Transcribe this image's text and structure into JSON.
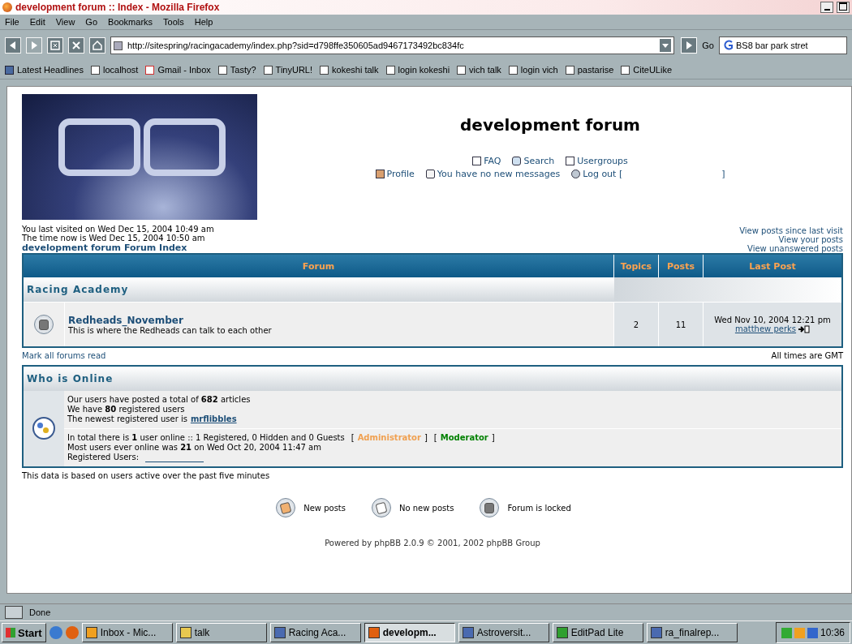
{
  "window": {
    "title": "development forum :: Index - Mozilla Firefox"
  },
  "menu": [
    "File",
    "Edit",
    "View",
    "Go",
    "Bookmarks",
    "Tools",
    "Help"
  ],
  "toolbar": {
    "url": "http://sitespring/racingacademy/index.php?sid=d798ffe350605ad9467173492bc834fc",
    "go": "Go",
    "search": "BS8 bar park stret"
  },
  "bookmarks": [
    {
      "label": "Latest Headlines",
      "kind": "feed"
    },
    {
      "label": "localhost",
      "kind": "site"
    },
    {
      "label": "Gmail - Inbox",
      "kind": "mail"
    },
    {
      "label": "Tasty?",
      "kind": "site"
    },
    {
      "label": "TinyURL!",
      "kind": "site"
    },
    {
      "label": "kokeshi talk",
      "kind": "site"
    },
    {
      "label": "login kokeshi",
      "kind": "site"
    },
    {
      "label": "vich talk",
      "kind": "site"
    },
    {
      "label": "login vich",
      "kind": "site"
    },
    {
      "label": "pastarise",
      "kind": "site"
    },
    {
      "label": "CiteULike",
      "kind": "site"
    }
  ],
  "site": {
    "title": "development forum",
    "nav_row_1": [
      {
        "label": "FAQ",
        "kind": "faq"
      },
      {
        "label": "Search",
        "kind": "search"
      },
      {
        "label": "Usergroups",
        "kind": "groups"
      }
    ],
    "nav_row_2": [
      {
        "label": "Profile",
        "kind": "profile"
      },
      {
        "label": "You have no new messages",
        "kind": "messages"
      },
      {
        "label": "Log out [",
        "kind": "logout"
      }
    ],
    "logout_close": "]"
  },
  "visit": [
    "You last visited on Wed Dec 15, 2004 10:49 am",
    "The time now is Wed Dec 15, 2004 10:50 am"
  ],
  "breadcrumb": "development forum Forum Index",
  "quick_links": [
    "View posts since last visit",
    "View your posts",
    "View unanswered posts"
  ],
  "table": {
    "columns": [
      "Forum",
      "Topics",
      "Posts",
      "Last Post"
    ],
    "category": "Racing Academy",
    "rows": [
      {
        "name": "Redheads_November",
        "description": "This is where the Redheads can talk to each other",
        "topics": "2",
        "posts": "11",
        "last_post_date": "Wed Nov 10, 2004 12:21 pm",
        "last_post_user": "matthew perks",
        "kind": "locked"
      }
    ]
  },
  "mark_read": "Mark all forums read",
  "timezone": "All times are GMT",
  "online": {
    "title": "Who is Online",
    "stats": [
      "Our users have posted a total of **682** articles",
      "We have **80** registered users",
      "The newest registered user is"
    ],
    "newest_user": "mrflibbles",
    "online_line": "In total there is **1** user online :: 1 Registered, 0 Hidden and 0 Guests",
    "groups": [
      {
        "open": "[",
        "label": "Administrator",
        "close": "]",
        "color": "#f0a050"
      },
      {
        "open": "[",
        "label": "Moderator",
        "close": "]",
        "color": "#008000"
      }
    ],
    "record": "Most users ever online was **21** on Wed Oct 20, 2004 11:47 am",
    "registered": "Registered Users:"
  },
  "active_note": "This data is based on users active over the past five minutes",
  "legend": [
    {
      "label": "New posts",
      "kind": "new"
    },
    {
      "label": "No new posts",
      "kind": "none"
    },
    {
      "label": "Forum is locked",
      "kind": "locked"
    }
  ],
  "footer": "Powered by phpBB 2.0.9 © 2001, 2002 phpBB Group",
  "status_bar": "Done",
  "taskbar": {
    "start": "Start",
    "items": [
      {
        "label": "Inbox - Mic...",
        "kind": "clock",
        "selected": false
      },
      {
        "label": "talk",
        "kind": "folder",
        "selected": false
      },
      {
        "label": "Racing Aca...",
        "kind": "doc",
        "selected": false
      },
      {
        "label": "developm...",
        "kind": "fox",
        "selected": true
      },
      {
        "label": "Astroversit...",
        "kind": "doc",
        "selected": false
      },
      {
        "label": "EditPad Lite",
        "kind": "pad",
        "selected": false
      },
      {
        "label": "ra_finalrep...",
        "kind": "doc",
        "selected": false
      }
    ],
    "clock": "10:36"
  }
}
